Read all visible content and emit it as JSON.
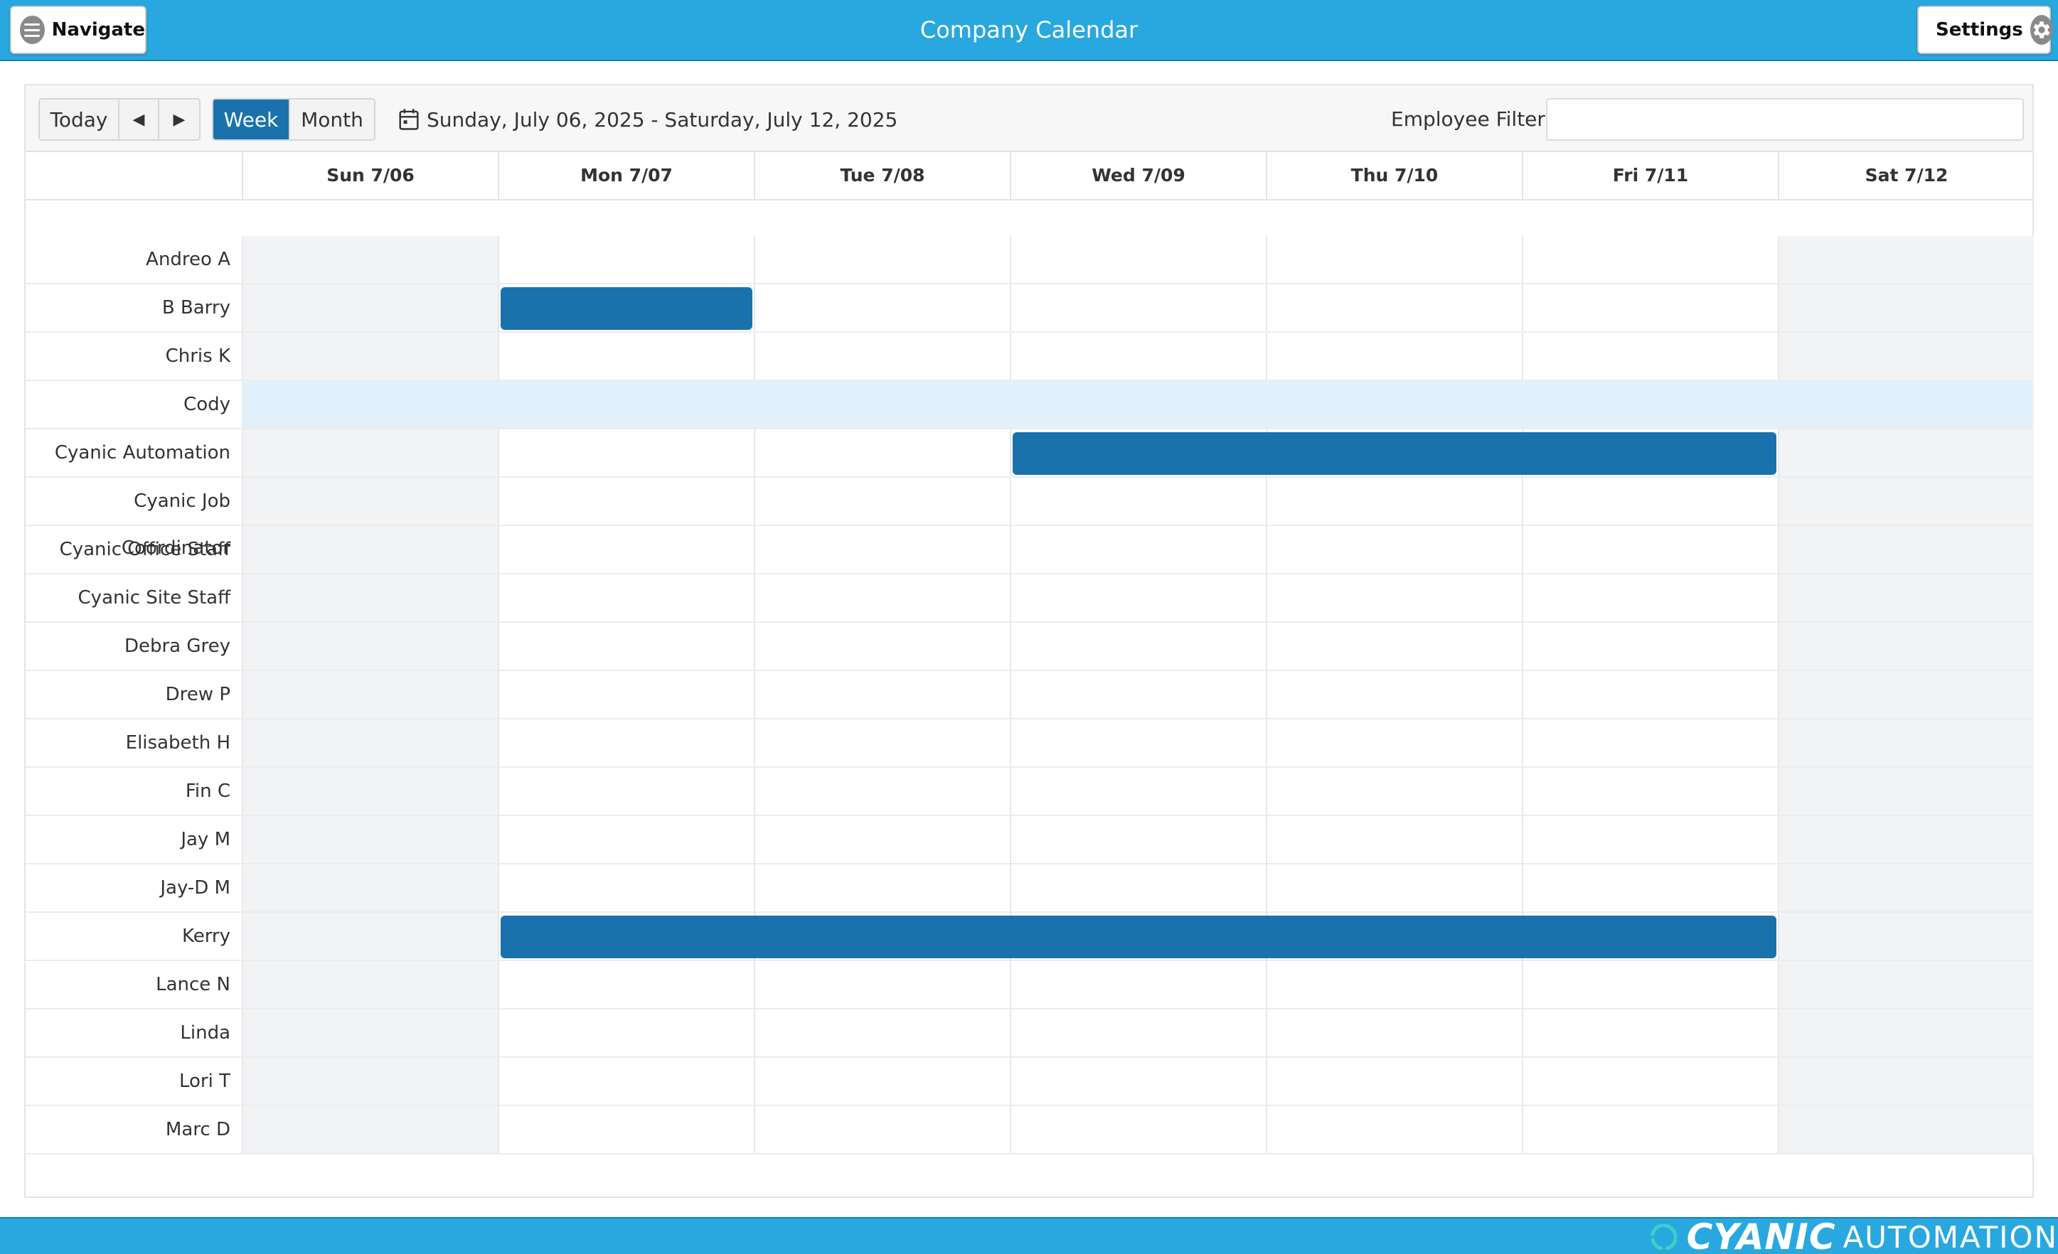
{
  "header": {
    "nav_label": "Navigate",
    "title": "Company Calendar",
    "settings_label": "Settings"
  },
  "toolbar": {
    "today_label": "Today",
    "prev_icon": "◀",
    "next_icon": "▶",
    "week_label": "Week",
    "month_label": "Month",
    "active_view": "Week",
    "date_range": "Sunday, July 06, 2025 - Saturday, July 12, 2025",
    "filter_label": "Employee Filter:",
    "filter_value": ""
  },
  "days": [
    "Sun 7/06",
    "Mon 7/07",
    "Tue 7/08",
    "Wed 7/09",
    "Thu 7/10",
    "Fri 7/11",
    "Sat 7/12"
  ],
  "weekend_days": [
    0,
    6
  ],
  "employees": [
    "Andreo A",
    "B Barry",
    "Chris K",
    "Cody",
    "Cyanic Automation",
    "Cyanic Job Coordinator",
    "Cyanic Office Staff",
    "Cyanic Site Staff",
    "Debra Grey",
    "Drew P",
    "Elisabeth H",
    "Fin C",
    "Jay M",
    "Jay-D M",
    "Kerry",
    "Lance N",
    "Linda",
    "Lori T",
    "Marc D"
  ],
  "highlighted_employee": "Cody",
  "events": [
    {
      "employee": "B Barry",
      "start_day": "Mon 7/07",
      "end_day": "Mon 7/07"
    },
    {
      "employee": "Cyanic Automation",
      "start_day": "Wed 7/09",
      "end_day": "Fri 7/11"
    },
    {
      "employee": "Kerry",
      "start_day": "Mon 7/07",
      "end_day": "Fri 7/11"
    }
  ],
  "colors": {
    "header_bar": "#29a8e0",
    "event": "#1a72ad",
    "active_button": "#1a72ad",
    "weekend_column": "#f2f3f4",
    "highlight_row": "#e2f0fb"
  },
  "footer": {
    "brand_word1": "CYANIC",
    "brand_word2": "AUTOMATION"
  }
}
